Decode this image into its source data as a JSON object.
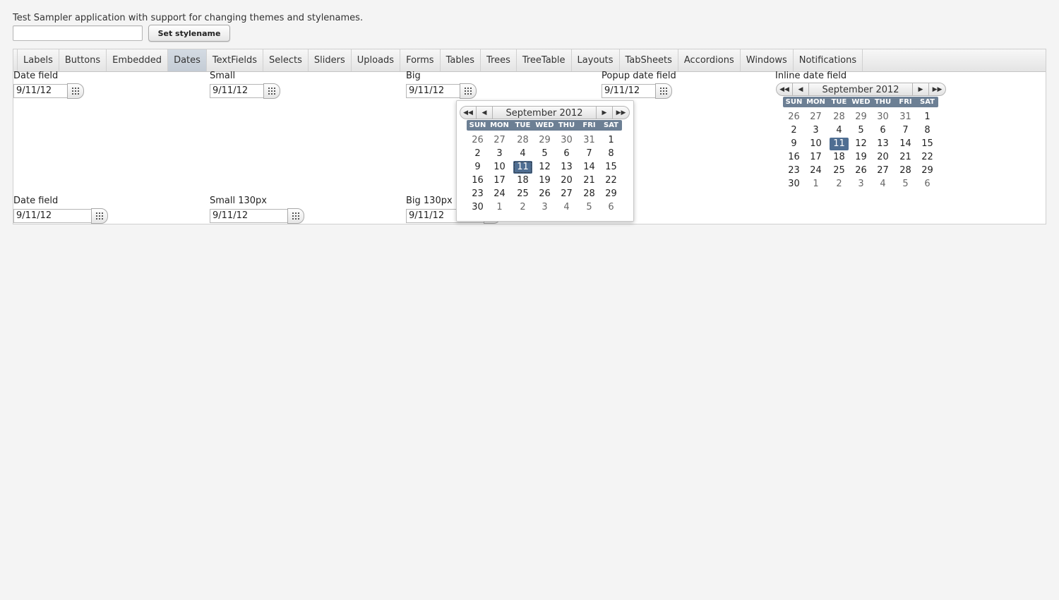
{
  "header": {
    "description": "Test Sampler application with support for changing themes and stylenames.",
    "stylename_value": "",
    "set_stylename_label": "Set stylename"
  },
  "tabs": [
    {
      "label": "Labels",
      "active": false
    },
    {
      "label": "Buttons",
      "active": false
    },
    {
      "label": "Embedded",
      "active": false
    },
    {
      "label": "Dates",
      "active": true
    },
    {
      "label": "TextFields",
      "active": false
    },
    {
      "label": "Selects",
      "active": false
    },
    {
      "label": "Sliders",
      "active": false
    },
    {
      "label": "Uploads",
      "active": false
    },
    {
      "label": "Forms",
      "active": false
    },
    {
      "label": "Tables",
      "active": false
    },
    {
      "label": "Trees",
      "active": false
    },
    {
      "label": "TreeTable",
      "active": false
    },
    {
      "label": "Layouts",
      "active": false
    },
    {
      "label": "TabSheets",
      "active": false
    },
    {
      "label": "Accordions",
      "active": false
    },
    {
      "label": "Windows",
      "active": false
    },
    {
      "label": "Notifications",
      "active": false
    }
  ],
  "fields": [
    {
      "label": "Date field",
      "value": "9/11/12"
    },
    {
      "label": "Small",
      "value": "9/11/12"
    },
    {
      "label": "Big",
      "value": "9/11/12"
    },
    {
      "label": "Popup date field",
      "value": "9/11/12"
    },
    {
      "label": "Inline date field"
    },
    {
      "label": "Date field",
      "value": "9/11/12"
    },
    {
      "label": "Small 130px",
      "value": "9/11/12"
    },
    {
      "label": "Big 130px",
      "value": "9/11/12"
    }
  ],
  "calendar": {
    "month_label": "September 2012",
    "prev_year_glyph": "◀◀",
    "prev_month_glyph": "◀",
    "next_month_glyph": "▶",
    "next_year_glyph": "▶▶",
    "weekdays": [
      "SUN",
      "MON",
      "TUE",
      "WED",
      "THU",
      "FRI",
      "SAT"
    ],
    "weeks": [
      [
        "26",
        "27",
        "28",
        "29",
        "30",
        "31",
        "1"
      ],
      [
        "2",
        "3",
        "4",
        "5",
        "6",
        "7",
        "8"
      ],
      [
        "9",
        "10",
        "11",
        "12",
        "13",
        "14",
        "15"
      ],
      [
        "16",
        "17",
        "18",
        "19",
        "20",
        "21",
        "22"
      ],
      [
        "23",
        "24",
        "25",
        "26",
        "27",
        "28",
        "29"
      ],
      [
        "30",
        "1",
        "2",
        "3",
        "4",
        "5",
        "6"
      ]
    ],
    "selected_day": "11"
  },
  "colors": {
    "weekday_header": "#6c7f94",
    "selected_day": "#4f6e92",
    "active_tab": "#c9d1da"
  }
}
